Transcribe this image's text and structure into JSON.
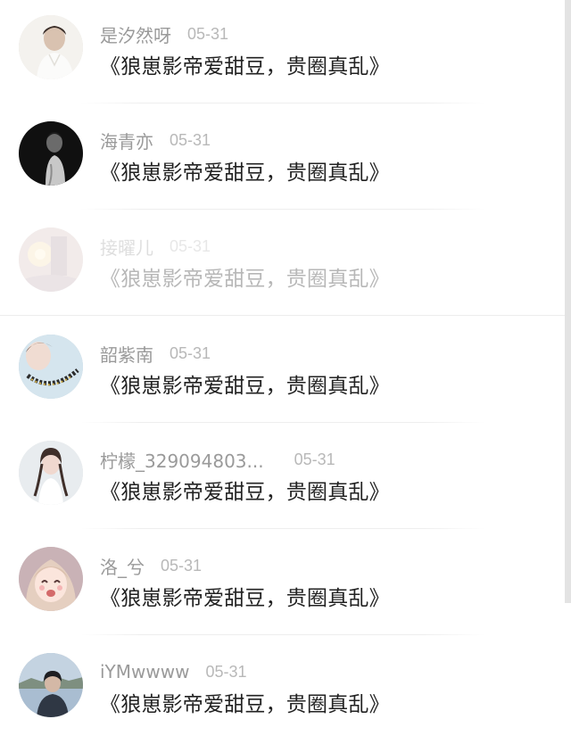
{
  "comments": [
    {
      "name": "是汐然呀",
      "date": "05-31",
      "text": "《狼崽影帝爱甜豆，贵圈真乱》",
      "avatar": "avatar-white-shirt-portrait"
    },
    {
      "name": "海青亦",
      "date": "05-31",
      "text": "《狼崽影帝爱甜豆，贵圈真乱》",
      "avatar": "avatar-dark-silhouette"
    },
    {
      "name": "接曜儿",
      "date": "05-31",
      "text": "《狼崽影帝爱甜豆，贵圈真乱》",
      "avatar": "avatar-candle-glow"
    },
    {
      "name": "韶紫南",
      "date": "05-31",
      "text": "《狼崽影帝爱甜豆，贵圈真乱》",
      "avatar": "avatar-girl-pearls"
    },
    {
      "name": "柠檬_329094803...",
      "date": "05-31",
      "text": "《狼崽影帝爱甜豆，贵圈真乱》",
      "avatar": "avatar-girl-braids"
    },
    {
      "name": "洛_兮",
      "date": "05-31",
      "text": "《狼崽影帝爱甜豆，贵圈真乱》",
      "avatar": "avatar-anime-girl-crying"
    },
    {
      "name": "iYMwwww",
      "date": "05-31",
      "text": "《狼崽影帝爱甜豆，贵圈真乱》",
      "avatar": "avatar-boy-outdoor"
    }
  ],
  "colors": {
    "name_text": "#9a9a9a",
    "date_text": "#b8b8b8",
    "message_text": "#222222"
  }
}
